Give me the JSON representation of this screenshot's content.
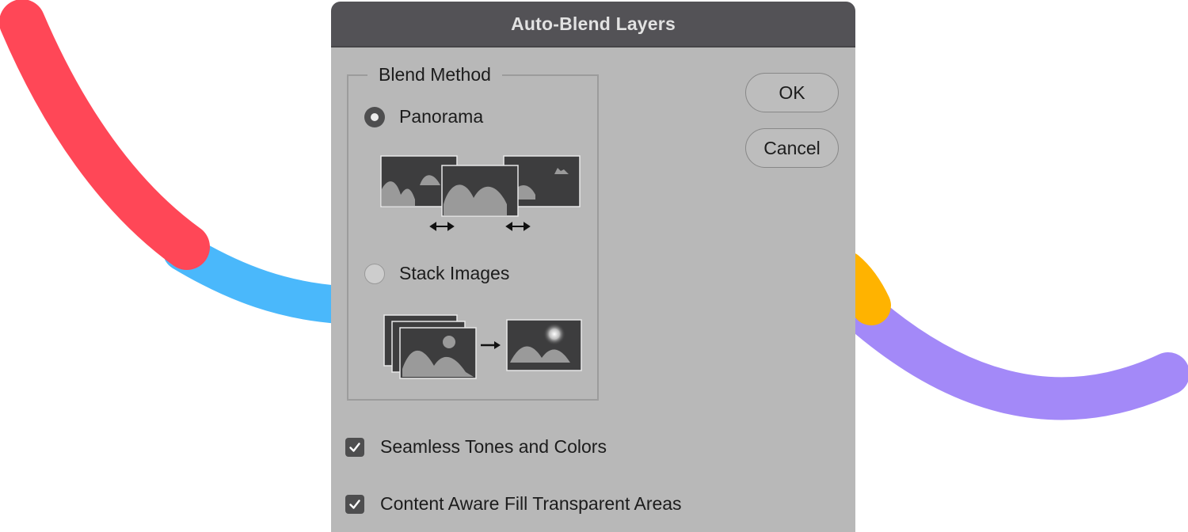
{
  "dialog": {
    "title": "Auto-Blend Layers",
    "blend_method": {
      "legend": "Blend Method",
      "options": [
        {
          "label": "Panorama",
          "selected": true
        },
        {
          "label": "Stack Images",
          "selected": false
        }
      ]
    },
    "buttons": {
      "ok": "OK",
      "cancel": "Cancel"
    },
    "checkboxes": [
      {
        "label": "Seamless Tones and Colors",
        "checked": true
      },
      {
        "label": "Content Aware Fill Transparent Areas",
        "checked": true
      }
    ]
  },
  "colors": {
    "curve_red": "#ff4757",
    "curve_blue": "#4ab8fb",
    "curve_orange": "#ffb300",
    "curve_purple": "#a389f8",
    "titlebar": "#535256",
    "dialog_body": "#b8b8b8"
  }
}
